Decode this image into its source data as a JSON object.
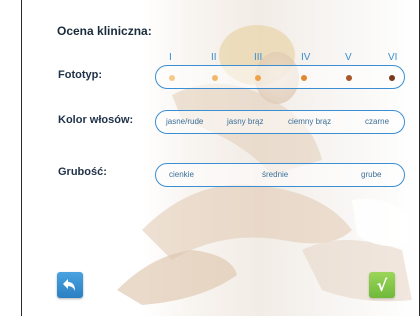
{
  "title": "Ocena kliniczna:",
  "fototyp": {
    "label": "Fototyp:",
    "numerals": [
      "I",
      "II",
      "III",
      "IV",
      "V",
      "VI"
    ],
    "dot_colors": [
      "#f5c98a",
      "#f2b86a",
      "#f0a24a",
      "#e08a2e",
      "#a8562a",
      "#7a3a1e"
    ]
  },
  "kolor": {
    "label": "Kolor włosów:",
    "options": [
      "jasne/rude",
      "jasny brąz",
      "ciemny brąz",
      "czarne"
    ]
  },
  "grubosc": {
    "label": "Grubość:",
    "options": [
      "cienkie",
      "średnie",
      "grube"
    ]
  },
  "buttons": {
    "back_icon": "back-arrow-icon",
    "ok_icon": "checkmark-icon",
    "ok_glyph": "√"
  }
}
